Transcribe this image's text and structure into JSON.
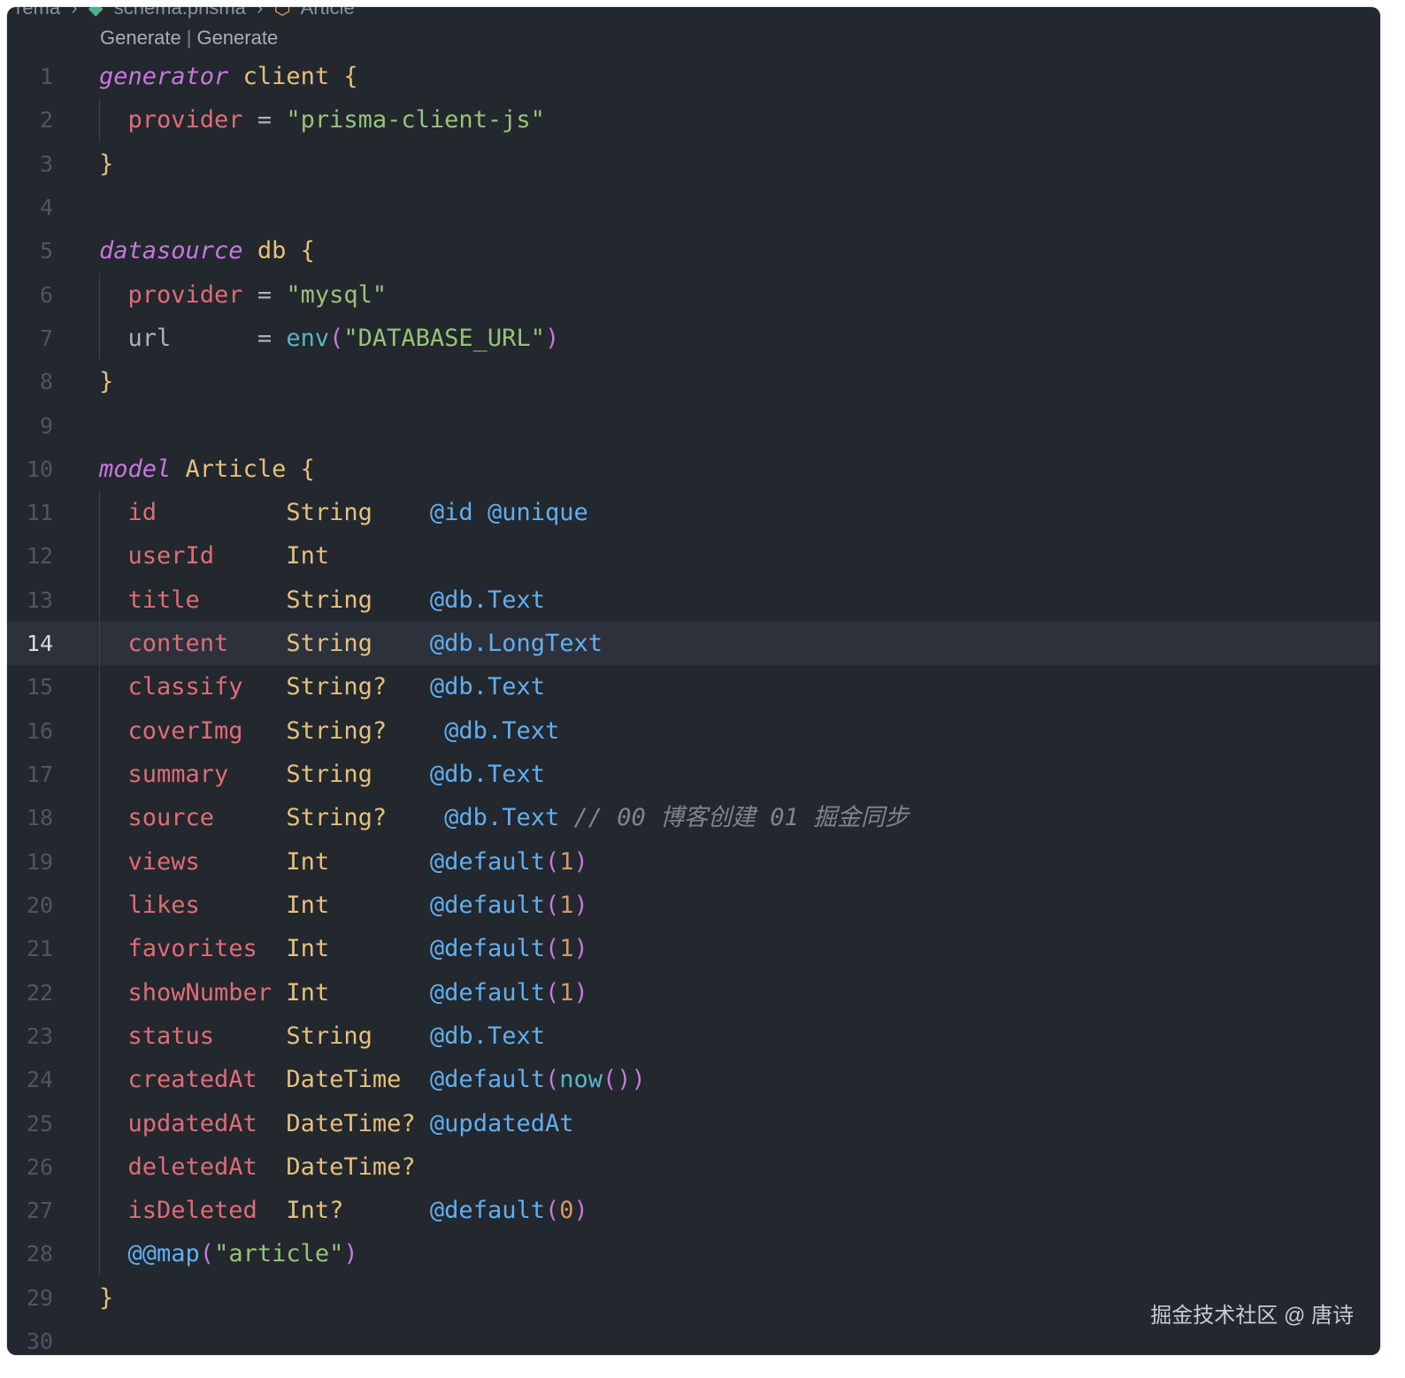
{
  "breadcrumb": [
    "rema",
    "schema.prisma",
    "Article"
  ],
  "codelens": {
    "left": "Generate",
    "separator": "|",
    "right": "Generate"
  },
  "lines": [
    {
      "n": "1",
      "t": [
        [
          "kw",
          "generator"
        ],
        [
          "op",
          " "
        ],
        [
          "name",
          "client"
        ],
        [
          "op",
          " "
        ],
        [
          "brace",
          "{"
        ]
      ]
    },
    {
      "n": "2",
      "i": true,
      "t": [
        [
          "field",
          "provider"
        ],
        [
          "op",
          " = "
        ],
        [
          "str",
          "\"prisma-client-js\""
        ]
      ]
    },
    {
      "n": "3",
      "t": [
        [
          "brace",
          "}"
        ]
      ]
    },
    {
      "n": "4",
      "t": []
    },
    {
      "n": "5",
      "t": [
        [
          "kw",
          "datasource"
        ],
        [
          "op",
          " "
        ],
        [
          "name",
          "db"
        ],
        [
          "op",
          " "
        ],
        [
          "brace",
          "{"
        ]
      ]
    },
    {
      "n": "6",
      "i": true,
      "t": [
        [
          "field",
          "provider"
        ],
        [
          "op",
          " = "
        ],
        [
          "str",
          "\"mysql\""
        ]
      ]
    },
    {
      "n": "7",
      "i": true,
      "t": [
        [
          "op",
          "url      = "
        ],
        [
          "fn",
          "env"
        ],
        [
          "paren",
          "("
        ],
        [
          "str",
          "\"DATABASE_URL\""
        ],
        [
          "paren",
          ")"
        ]
      ]
    },
    {
      "n": "8",
      "t": [
        [
          "brace",
          "}"
        ]
      ]
    },
    {
      "n": "9",
      "t": []
    },
    {
      "n": "10",
      "t": [
        [
          "kw",
          "model"
        ],
        [
          "op",
          " "
        ],
        [
          "name",
          "Article"
        ],
        [
          "op",
          " "
        ],
        [
          "brace",
          "{"
        ]
      ]
    },
    {
      "n": "11",
      "i": true,
      "t": [
        [
          "field",
          "id"
        ],
        [
          "op",
          "         "
        ],
        [
          "type",
          "String"
        ],
        [
          "op",
          "    "
        ],
        [
          "attr",
          "@id"
        ],
        [
          "op",
          " "
        ],
        [
          "attr",
          "@unique"
        ]
      ]
    },
    {
      "n": "12",
      "i": true,
      "t": [
        [
          "field",
          "userId"
        ],
        [
          "op",
          "     "
        ],
        [
          "type",
          "Int"
        ]
      ]
    },
    {
      "n": "13",
      "i": true,
      "t": [
        [
          "field",
          "title"
        ],
        [
          "op",
          "      "
        ],
        [
          "type",
          "String"
        ],
        [
          "op",
          "    "
        ],
        [
          "attr",
          "@db.Text"
        ]
      ]
    },
    {
      "n": "14",
      "i": true,
      "active": true,
      "t": [
        [
          "field",
          "content"
        ],
        [
          "op",
          "    "
        ],
        [
          "type",
          "String"
        ],
        [
          "op",
          "    "
        ],
        [
          "attr",
          "@db.LongText"
        ]
      ]
    },
    {
      "n": "15",
      "i": true,
      "t": [
        [
          "field",
          "classify"
        ],
        [
          "op",
          "   "
        ],
        [
          "type",
          "String?"
        ],
        [
          "op",
          "   "
        ],
        [
          "attr",
          "@db.Text"
        ]
      ]
    },
    {
      "n": "16",
      "i": true,
      "t": [
        [
          "field",
          "coverImg"
        ],
        [
          "op",
          "   "
        ],
        [
          "type",
          "String?"
        ],
        [
          "op",
          "    "
        ],
        [
          "attr",
          "@db.Text"
        ]
      ]
    },
    {
      "n": "17",
      "i": true,
      "t": [
        [
          "field",
          "summary"
        ],
        [
          "op",
          "    "
        ],
        [
          "type",
          "String"
        ],
        [
          "op",
          "    "
        ],
        [
          "attr",
          "@db.Text"
        ]
      ]
    },
    {
      "n": "18",
      "i": true,
      "t": [
        [
          "field",
          "source"
        ],
        [
          "op",
          "     "
        ],
        [
          "type",
          "String?"
        ],
        [
          "op",
          "    "
        ],
        [
          "attr",
          "@db.Text"
        ],
        [
          "op",
          " "
        ],
        [
          "cmt",
          "// 00 博客创建 01 掘金同步"
        ]
      ]
    },
    {
      "n": "19",
      "i": true,
      "t": [
        [
          "field",
          "views"
        ],
        [
          "op",
          "      "
        ],
        [
          "type",
          "Int"
        ],
        [
          "op",
          "       "
        ],
        [
          "attr",
          "@default"
        ],
        [
          "paren",
          "("
        ],
        [
          "num",
          "1"
        ],
        [
          "paren",
          ")"
        ]
      ]
    },
    {
      "n": "20",
      "i": true,
      "t": [
        [
          "field",
          "likes"
        ],
        [
          "op",
          "      "
        ],
        [
          "type",
          "Int"
        ],
        [
          "op",
          "       "
        ],
        [
          "attr",
          "@default"
        ],
        [
          "paren",
          "("
        ],
        [
          "num",
          "1"
        ],
        [
          "paren",
          ")"
        ]
      ]
    },
    {
      "n": "21",
      "i": true,
      "t": [
        [
          "field",
          "favorites"
        ],
        [
          "op",
          "  "
        ],
        [
          "type",
          "Int"
        ],
        [
          "op",
          "       "
        ],
        [
          "attr",
          "@default"
        ],
        [
          "paren",
          "("
        ],
        [
          "num",
          "1"
        ],
        [
          "paren",
          ")"
        ]
      ]
    },
    {
      "n": "22",
      "i": true,
      "t": [
        [
          "field",
          "showNumber"
        ],
        [
          "op",
          " "
        ],
        [
          "type",
          "Int"
        ],
        [
          "op",
          "       "
        ],
        [
          "attr",
          "@default"
        ],
        [
          "paren",
          "("
        ],
        [
          "num",
          "1"
        ],
        [
          "paren",
          ")"
        ]
      ]
    },
    {
      "n": "23",
      "i": true,
      "t": [
        [
          "field",
          "status"
        ],
        [
          "op",
          "     "
        ],
        [
          "type",
          "String"
        ],
        [
          "op",
          "    "
        ],
        [
          "attr",
          "@db.Text"
        ]
      ]
    },
    {
      "n": "24",
      "i": true,
      "t": [
        [
          "field",
          "createdAt"
        ],
        [
          "op",
          "  "
        ],
        [
          "type",
          "DateTime"
        ],
        [
          "op",
          "  "
        ],
        [
          "attr",
          "@default"
        ],
        [
          "paren",
          "("
        ],
        [
          "fn",
          "now"
        ],
        [
          "paren",
          "()"
        ],
        [
          "paren",
          ")"
        ]
      ]
    },
    {
      "n": "25",
      "i": true,
      "t": [
        [
          "field",
          "updatedAt"
        ],
        [
          "op",
          "  "
        ],
        [
          "type",
          "DateTime?"
        ],
        [
          "op",
          " "
        ],
        [
          "attr",
          "@updatedAt"
        ]
      ]
    },
    {
      "n": "26",
      "i": true,
      "t": [
        [
          "field",
          "deletedAt"
        ],
        [
          "op",
          "  "
        ],
        [
          "type",
          "DateTime?"
        ]
      ]
    },
    {
      "n": "27",
      "i": true,
      "t": [
        [
          "field",
          "isDeleted"
        ],
        [
          "op",
          "  "
        ],
        [
          "type",
          "Int?"
        ],
        [
          "op",
          "      "
        ],
        [
          "attr",
          "@default"
        ],
        [
          "paren",
          "("
        ],
        [
          "num",
          "0"
        ],
        [
          "paren",
          ")"
        ]
      ]
    },
    {
      "n": "28",
      "i": true,
      "t": [
        [
          "attr",
          "@@map"
        ],
        [
          "paren",
          "("
        ],
        [
          "str",
          "\"article\""
        ],
        [
          "paren",
          ")"
        ]
      ]
    },
    {
      "n": "29",
      "t": [
        [
          "brace",
          "}"
        ]
      ]
    },
    {
      "n": "30",
      "t": []
    }
  ],
  "watermark": "掘金技术社区 @ 唐诗"
}
